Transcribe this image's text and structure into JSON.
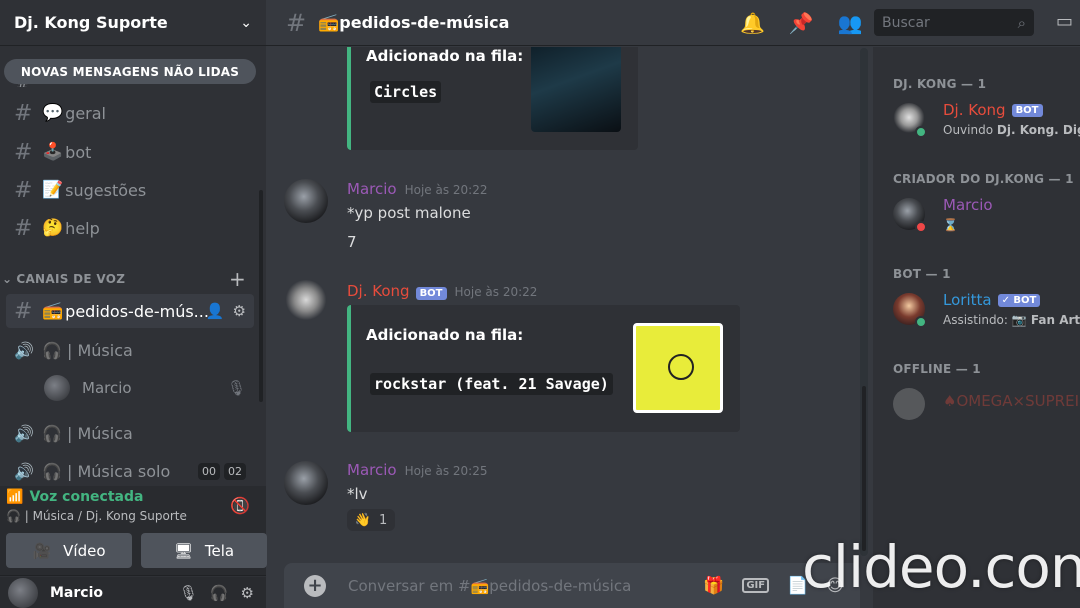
{
  "server": {
    "name": "Dj. Kong Suporte"
  },
  "sidebar": {
    "unread_banner": "NOVAS MENSAGENS NÃO LIDAS",
    "text_channels": [
      {
        "emoji": "💬",
        "label": "geral"
      },
      {
        "emoji": "🕹️",
        "label": "bot"
      },
      {
        "emoji": "📝",
        "label": "sugestões"
      },
      {
        "emoji": "🤔",
        "label": "help"
      }
    ],
    "voice_category": "CANAIS DE VOZ",
    "active_channel": {
      "emoji": "📻",
      "label": "pedidos-de-mús..."
    },
    "voice_channels": [
      {
        "label": "🎧 | Música"
      },
      {
        "label": "🎧 | Música"
      },
      {
        "label": "🎧 | Música solo"
      }
    ],
    "voice_user": "Marcio",
    "timer": [
      "00",
      "02"
    ]
  },
  "voice_panel": {
    "status": "Voz conectada",
    "location": "🎧 | Música / Dj. Kong Suporte",
    "video_label": "Vídeo",
    "screen_label": "Tela"
  },
  "user_panel": {
    "name": "Marcio"
  },
  "topbar": {
    "channel_emoji": "📻",
    "channel_name": "pedidos-de-música",
    "search_placeholder": "Buscar"
  },
  "messages": {
    "embed1": {
      "head": "Adicionado na fila:",
      "track": "Circles"
    },
    "m1": {
      "author": "Marcio",
      "time": "Hoje às 20:22",
      "lines": [
        "*yp post malone",
        "7"
      ]
    },
    "m2": {
      "author": "Dj. Kong",
      "badge": "BOT",
      "time": "Hoje às 20:22",
      "embed_head": "Adicionado na fila:",
      "track": "rockstar (feat. 21 Savage)"
    },
    "m3": {
      "author": "Marcio",
      "time": "Hoje às 20:25",
      "text": "*lv",
      "reaction_emoji": "👋",
      "reaction_count": "1"
    }
  },
  "composer": {
    "placeholder": "Conversar em #📻pedidos-de-música",
    "gif": "GIF"
  },
  "members": {
    "cat1": "DJ. KONG — 1",
    "djkong": {
      "name": "Dj. Kong",
      "badge": "BOT",
      "activity_prefix": "Ouvindo",
      "activity": "Dj. Kong. Digit"
    },
    "cat2": "CRIADOR DO DJ.KONG — 1",
    "marcio": {
      "name": "Marcio",
      "activity": "⌛"
    },
    "cat3": "BOT — 1",
    "loritta": {
      "name": "Loritta",
      "badge": "✓ BOT",
      "activity_prefix": "Assistindo:",
      "activity": "📷 Fan Art b"
    },
    "cat4": "OFFLINE — 1",
    "omega": {
      "name": "♠OMEGA×SUPREI"
    }
  },
  "watermark": "clideo.con",
  "colors": {
    "accent_green": "#43b581",
    "marcio_purple": "#9b59b6",
    "djkong_red": "#e74c3c",
    "loritta_blue": "#3498db",
    "bot_badge": "#7289da"
  }
}
